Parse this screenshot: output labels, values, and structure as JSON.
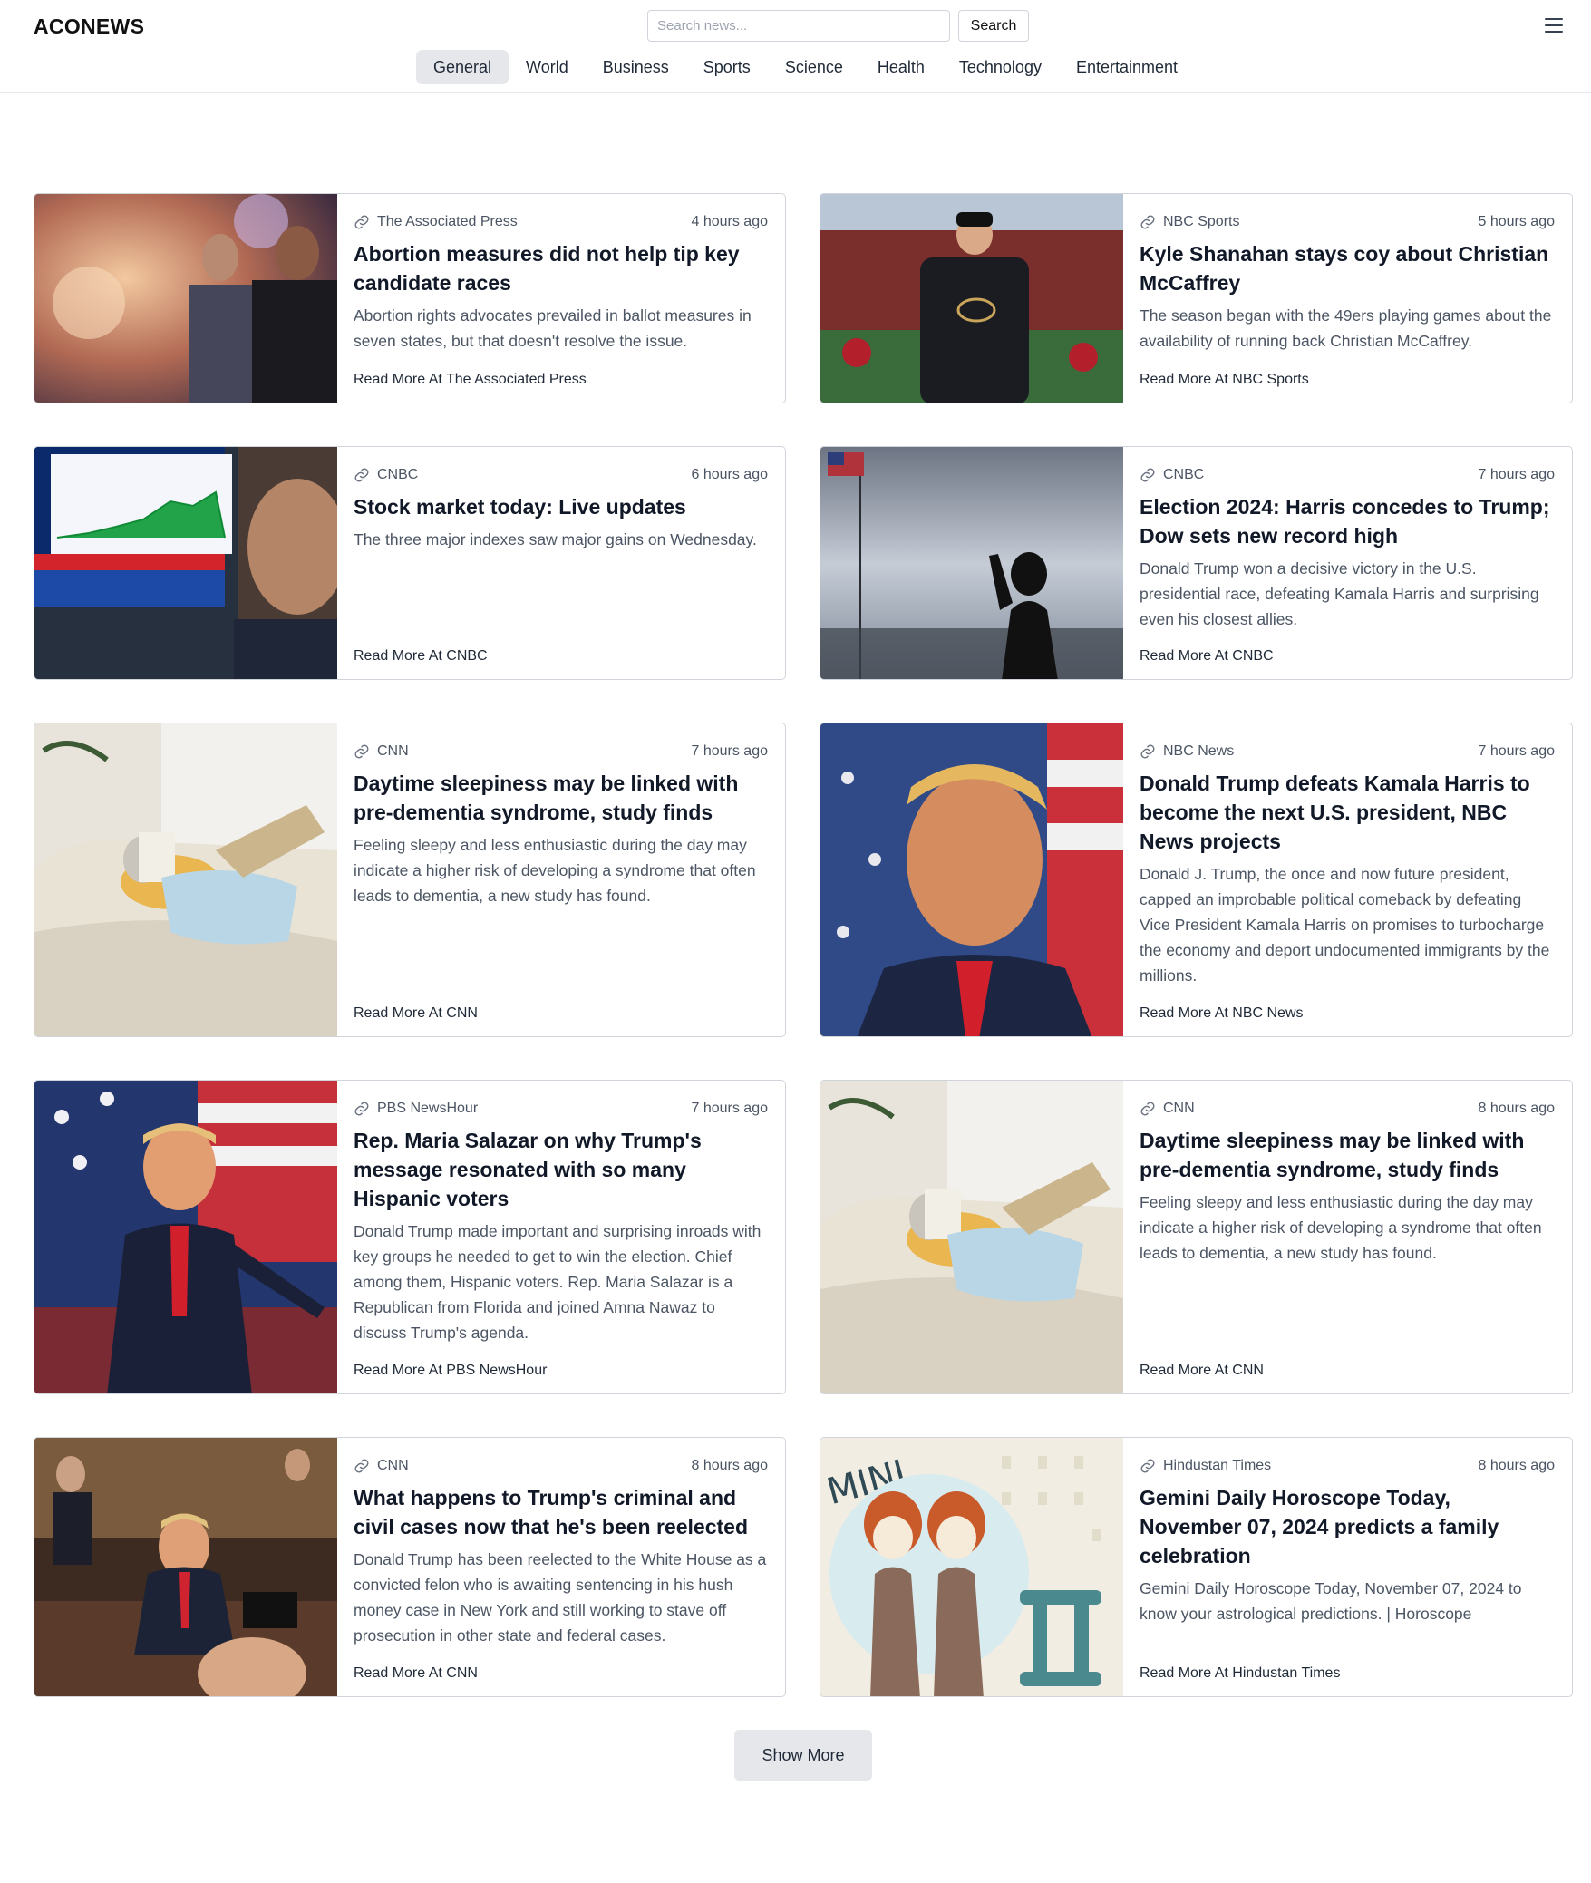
{
  "header": {
    "logo": "ACONEWS",
    "search_placeholder": "Search news...",
    "search_button": "Search",
    "menu_icon": "hamburger-menu-icon"
  },
  "nav": {
    "tabs": [
      {
        "label": "General",
        "active": true
      },
      {
        "label": "World"
      },
      {
        "label": "Business"
      },
      {
        "label": "Sports"
      },
      {
        "label": "Science"
      },
      {
        "label": "Health"
      },
      {
        "label": "Technology"
      },
      {
        "label": "Entertainment"
      }
    ]
  },
  "articles": [
    {
      "source": "The Associated Press",
      "time": "4 hours ago",
      "title": "Abortion measures did not help tip key candidate races",
      "desc": "Abortion rights advocates prevailed in ballot measures in seven states, but that doesn't resolve the issue.",
      "read_more": "Read More At The Associated Press"
    },
    {
      "source": "NBC Sports",
      "time": "5 hours ago",
      "title": "Kyle Shanahan stays coy about Christian McCaffrey",
      "desc": "The season began with the 49ers playing games about the availability of running back Christian McCaffrey.",
      "read_more": "Read More At NBC Sports"
    },
    {
      "source": "CNBC",
      "time": "6 hours ago",
      "title": "Stock market today: Live updates",
      "desc": "The three major indexes saw major gains on Wednesday.",
      "read_more": "Read More At CNBC"
    },
    {
      "source": "CNBC",
      "time": "7 hours ago",
      "title": "Election 2024: Harris concedes to Trump; Dow sets new record high",
      "desc": "Donald Trump won a decisive victory in the U.S. presidential race, defeating Kamala Harris and surprising even his closest allies.",
      "read_more": "Read More At CNBC"
    },
    {
      "source": "CNN",
      "time": "7 hours ago",
      "title": "Daytime sleepiness may be linked with pre-dementia syndrome, study finds",
      "desc": "Feeling sleepy and less enthusiastic during the day may indicate a higher risk of developing a syndrome that often leads to dementia, a new study has found.",
      "read_more": "Read More At CNN"
    },
    {
      "source": "NBC News",
      "time": "7 hours ago",
      "title": "Donald Trump defeats Kamala Harris to become the next U.S. president, NBC News projects",
      "desc": "Donald J. Trump, the once and now future president, capped an improbable political comeback by defeating Vice President Kamala Harris on promises to turbocharge the economy and deport undocumented immigrants by the millions.",
      "read_more": "Read More At NBC News"
    },
    {
      "source": "PBS NewsHour",
      "time": "7 hours ago",
      "title": "Rep. Maria Salazar on why Trump's message resonated with so many Hispanic voters",
      "desc": "Donald Trump made important and surprising inroads with key groups he needed to get to win the election. Chief among them, Hispanic voters. Rep. Maria Salazar is a Republican from Florida and joined Amna Nawaz to discuss Trump's agenda.",
      "read_more": "Read More At PBS NewsHour"
    },
    {
      "source": "CNN",
      "time": "8 hours ago",
      "title": "Daytime sleepiness may be linked with pre-dementia syndrome, study finds",
      "desc": "Feeling sleepy and less enthusiastic during the day may indicate a higher risk of developing a syndrome that often leads to dementia, a new study has found.",
      "read_more": "Read More At CNN"
    },
    {
      "source": "CNN",
      "time": "8 hours ago",
      "title": "What happens to Trump's criminal and civil cases now that he's been reelected",
      "desc": "Donald Trump has been reelected to the White House as a convicted felon who is awaiting sentencing in his hush money case in New York and still working to stave off prosecution in other state and federal cases.",
      "read_more": "Read More At CNN"
    },
    {
      "source": "Hindustan Times",
      "time": "8 hours ago",
      "title": "Gemini Daily Horoscope Today, November 07, 2024 predicts a family celebration",
      "desc": "Gemini Daily Horoscope Today, November 07, 2024 to know your astrological predictions. | Horoscope",
      "read_more": "Read More At Hindustan Times",
      "image_text": "MINI"
    }
  ],
  "show_more": "Show More"
}
